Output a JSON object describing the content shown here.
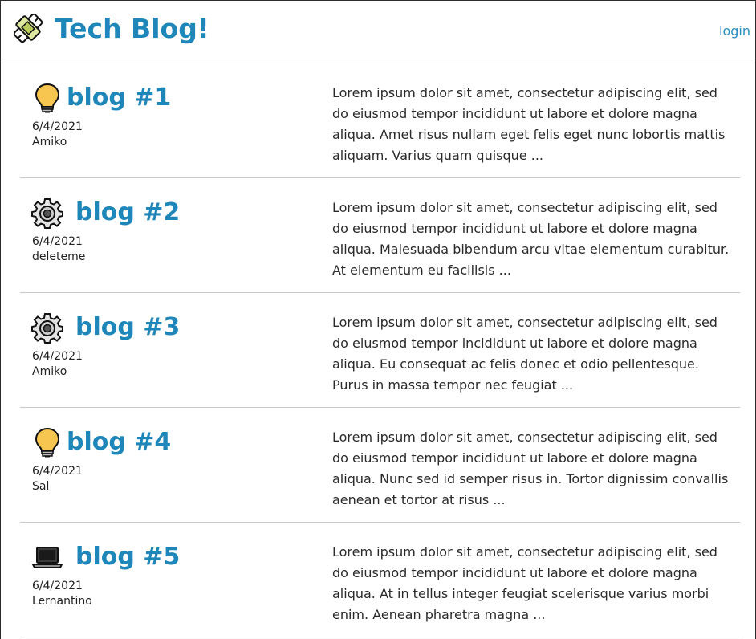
{
  "header": {
    "title": "Tech Blog!",
    "login_label": "login",
    "logo_icon": "wrench-chip-icon"
  },
  "colors": {
    "accent": "#1e86b8",
    "divider": "#c8c8c8"
  },
  "posts": [
    {
      "icon": "lightbulb-icon",
      "title": "blog #1",
      "date": "6/4/2021",
      "author": "Amiko",
      "excerpt": "Lorem ipsum dolor sit amet, consectetur adipiscing elit, sed do eiusmod tempor incididunt ut labore et dolore magna aliqua. Amet risus nullam eget felis eget nunc lobortis mattis aliquam. Varius quam quisque ..."
    },
    {
      "icon": "gear-icon",
      "title": "blog #2",
      "date": "6/4/2021",
      "author": "deleteme",
      "excerpt": "Lorem ipsum dolor sit amet, consectetur adipiscing elit, sed do eiusmod tempor incididunt ut labore et dolore magna aliqua. Malesuada bibendum arcu vitae elementum curabitur. At elementum eu facilisis ..."
    },
    {
      "icon": "gear-icon",
      "title": "blog #3",
      "date": "6/4/2021",
      "author": "Amiko",
      "excerpt": "Lorem ipsum dolor sit amet, consectetur adipiscing elit, sed do eiusmod tempor incididunt ut labore et dolore magna aliqua. Eu consequat ac felis donec et odio pellentesque. Purus in massa tempor nec feugiat ..."
    },
    {
      "icon": "lightbulb-icon",
      "title": "blog #4",
      "date": "6/4/2021",
      "author": "Sal",
      "excerpt": "Lorem ipsum dolor sit amet, consectetur adipiscing elit, sed do eiusmod tempor incididunt ut labore et dolore magna aliqua. Nunc sed id semper risus in. Tortor dignissim convallis aenean et tortor at risus ..."
    },
    {
      "icon": "laptop-icon",
      "title": "blog #5",
      "date": "6/4/2021",
      "author": "Lernantino",
      "excerpt": "Lorem ipsum dolor sit amet, consectetur adipiscing elit, sed do eiusmod tempor incididunt ut labore et dolore magna aliqua. At in tellus integer feugiat scelerisque varius morbi enim. Aenean pharetra magna ..."
    }
  ]
}
